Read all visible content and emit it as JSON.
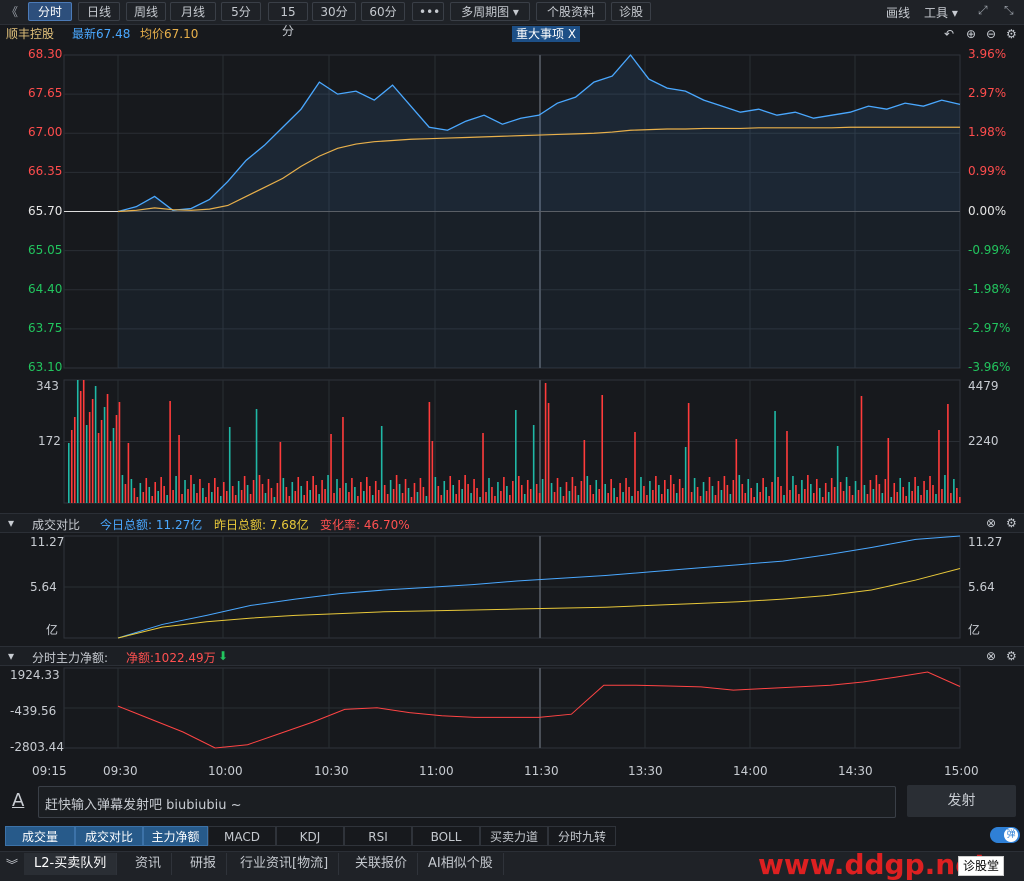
{
  "toolbar": {
    "back": "《",
    "tabs": [
      "分时",
      "日线",
      "周线",
      "月线",
      "5分",
      "15分",
      "30分",
      "60分",
      "•••",
      "多周期图 ▾",
      "个股资料",
      "诊股"
    ],
    "draw": "画线",
    "tools": "工具 ▾"
  },
  "info": {
    "name": "顺丰控股",
    "latest": "最新67.48",
    "avg": "均价67.10",
    "event": "重大事项  X"
  },
  "price_axis": {
    "left": [
      "68.30",
      "67.65",
      "67.00",
      "66.35",
      "65.70",
      "65.05",
      "64.40",
      "63.75",
      "63.10"
    ],
    "right": [
      "3.96%",
      "2.97%",
      "1.98%",
      "0.99%",
      "0.00%",
      "-0.99%",
      "-1.98%",
      "-2.97%",
      "-3.96%"
    ]
  },
  "volume_axis": {
    "left": [
      "343",
      "172"
    ],
    "right": [
      "4479",
      "2240"
    ]
  },
  "panel1": {
    "title": "成交对比",
    "today": "今日总额: 11.27亿",
    "yesterday": "昨日总额: 7.68亿",
    "change": "变化率: 46.70%",
    "axis_left": [
      "11.27",
      "5.64",
      "亿"
    ],
    "axis_right": [
      "11.27",
      "5.64",
      "亿"
    ]
  },
  "panel2": {
    "title": "分时主力净额:",
    "net": "净额:1022.49万",
    "arrow": "⬇",
    "axis_left": [
      "1924.33",
      "-439.56",
      "-2803.44"
    ]
  },
  "time_axis": [
    "09:15",
    "09:30",
    "10:00",
    "10:30",
    "11:00",
    "11:30",
    "13:30",
    "14:00",
    "14:30",
    "15:00"
  ],
  "danmu": {
    "placeholder": "赶快输入弹幕发射吧 biubiubiu ~",
    "send": "发射",
    "toggle": "弹"
  },
  "indicator_tabs": [
    "成交量",
    "成交对比",
    "主力净额",
    "MACD",
    "KDJ",
    "RSI",
    "BOLL",
    "买卖力道",
    "分时九转"
  ],
  "bottom_tabs": [
    "L2-买卖队列",
    "资讯",
    "研报",
    "行业资讯[物流]",
    "关联报价",
    "AI相似个股"
  ],
  "bottom_right": "诊股堂",
  "watermark": "www.ddgp.net",
  "colors": {
    "up": "#ff4444",
    "down": "#22c55e",
    "price": "#4aa8ff",
    "avg": "#e8b04b",
    "accent": "#2d4f7c"
  },
  "chart_data": [
    {
      "type": "line",
      "title": "",
      "series": [
        {
          "name": "最新",
          "values": [
            65.7,
            65.78,
            65.95,
            65.72,
            65.75,
            65.9,
            66.2,
            66.55,
            66.8,
            67.1,
            67.4,
            67.85,
            67.65,
            67.7,
            67.55,
            67.8,
            67.45,
            67.1,
            67.05,
            67.2,
            67.3,
            67.15,
            67.25,
            67.3,
            67.5,
            67.6,
            67.85,
            67.95,
            68.3,
            67.9,
            67.75,
            67.7,
            67.55,
            67.45,
            67.35,
            67.4,
            67.3,
            67.35,
            67.25,
            67.3,
            67.35,
            67.45,
            67.4,
            67.5,
            67.45,
            67.55,
            67.48
          ]
        },
        {
          "name": "均价",
          "values": [
            65.7,
            65.72,
            65.76,
            65.73,
            65.72,
            65.74,
            65.8,
            65.95,
            66.1,
            66.25,
            66.45,
            66.62,
            66.75,
            66.82,
            66.86,
            66.88,
            66.9,
            66.91,
            66.92,
            66.93,
            66.94,
            66.95,
            66.96,
            66.97,
            66.98,
            66.99,
            67.0,
            67.02,
            67.05,
            67.06,
            67.07,
            67.07,
            67.08,
            67.08,
            67.08,
            67.09,
            67.09,
            67.09,
            67.09,
            67.09,
            67.1,
            67.1,
            67.1,
            67.1,
            67.1,
            67.1,
            67.1
          ]
        }
      ],
      "ylim": [
        63.1,
        68.3
      ]
    },
    {
      "type": "line",
      "title": "成交对比",
      "series": [
        {
          "name": "今日总额",
          "values": [
            0,
            1.5,
            2.5,
            3.6,
            4.3,
            4.9,
            5.3,
            5.6,
            5.9,
            6.3,
            6.6,
            6.9,
            7.3,
            7.7,
            8.1,
            8.5,
            9.2,
            10.0,
            10.9,
            11.27
          ]
        },
        {
          "name": "昨日总额",
          "values": [
            0,
            1.2,
            1.8,
            2.2,
            2.5,
            2.7,
            2.9,
            3.0,
            3.1,
            3.2,
            3.3,
            3.4,
            3.6,
            3.8,
            4.0,
            4.3,
            4.7,
            5.3,
            6.4,
            7.68
          ]
        }
      ],
      "ylim": [
        0,
        11.27
      ]
    },
    {
      "type": "line",
      "title": "分时主力净额",
      "series": [
        {
          "name": "净额",
          "values": [
            -200,
            -1000,
            -1800,
            -2803,
            -2600,
            -1900,
            -1200,
            -400,
            -300,
            -600,
            -800,
            -900,
            -900,
            -900,
            -700,
            1100,
            1100,
            1050,
            1000,
            800,
            900,
            1000,
            1100,
            1300,
            1600,
            1924,
            1022
          ]
        }
      ],
      "ylim": [
        -2803.44,
        1924.33
      ]
    }
  ]
}
